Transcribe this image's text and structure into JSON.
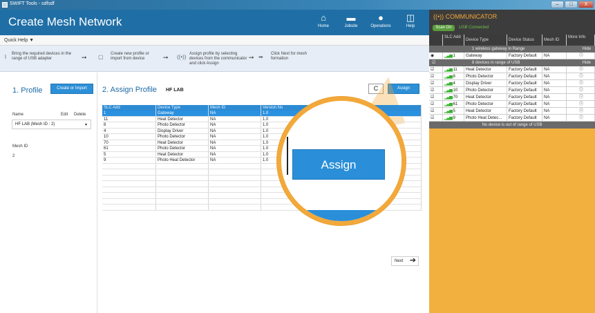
{
  "window": {
    "title": "SWIFT Tools - sdfsdf",
    "controls": [
      "–",
      "□",
      "X"
    ]
  },
  "header": {
    "title": "Create Mesh Network",
    "buttons": [
      {
        "label": "Home",
        "icon": "home-icon",
        "glyph": "⌂"
      },
      {
        "label": "Jobsite",
        "icon": "briefcase-icon",
        "glyph": "▬"
      },
      {
        "label": "Operations",
        "icon": "operations-icon",
        "glyph": "●"
      },
      {
        "label": "Help",
        "icon": "book-icon",
        "glyph": "◫"
      }
    ]
  },
  "quick_help": {
    "label": "Quick Help ▼",
    "steps": [
      "Bring the required devices in the range of USB adapter",
      "Create new profile or import from device",
      "Assign profile by selecting devices from the communicator and click  Assign",
      "Click Next for mesh formation"
    ]
  },
  "profile": {
    "section_title": "1. Profile",
    "create_import_label": "Create or Import",
    "name_label": "Name",
    "edit_label": "Edit",
    "delete_label": "Delete",
    "selected_profile": "HF LAB (Mesh ID : 2)",
    "mesh_id_label": "Mesh ID",
    "mesh_id_value": "2"
  },
  "assign": {
    "section_title": "2. Assign Profile",
    "profile_name": "HF LAB",
    "refresh_glyph": "C",
    "assign_label": "Assign",
    "next_label": "Next",
    "columns": [
      "SLC Add",
      "Device Type",
      "Mesh ID",
      "Version No",
      "",
      ""
    ],
    "rows": [
      {
        "slc": "1",
        "type": "Gateway",
        "mesh": "NA",
        "ver": "1.0"
      },
      {
        "slc": "11",
        "type": "Heat Detector",
        "mesh": "NA",
        "ver": "1.0"
      },
      {
        "slc": "8",
        "type": "Photo Detector",
        "mesh": "NA",
        "ver": "1.0"
      },
      {
        "slc": "4",
        "type": "Display Driver",
        "mesh": "NA",
        "ver": "1.0"
      },
      {
        "slc": "10",
        "type": "Photo Detector",
        "mesh": "NA",
        "ver": "1.0"
      },
      {
        "slc": "70",
        "type": "Heat Detector",
        "mesh": "NA",
        "ver": "1.0"
      },
      {
        "slc": "61",
        "type": "Photo Detector",
        "mesh": "NA",
        "ver": "1.0"
      },
      {
        "slc": "5",
        "type": "Heat Detector",
        "mesh": "NA",
        "ver": "1.0"
      },
      {
        "slc": "9",
        "type": "Photo Heat Detector",
        "mesh": "NA",
        "ver": "1.0"
      }
    ],
    "zoom_assign_label": "Assign",
    "zoom_partial_label": "ign"
  },
  "communicator": {
    "title": "COMMUNICATOR",
    "scan_label": "Scan On",
    "usb_status": "USB Connected",
    "columns": [
      "SLC Add",
      "Device Type",
      "Device Status",
      "Mesh ID",
      "More Info"
    ],
    "gateway_group": {
      "label": "1 wireless gateway in Range",
      "hide": "Hide"
    },
    "gateway_row": {
      "slc": "1",
      "type": "Gateway",
      "status": "Factory Default",
      "mesh": "NA"
    },
    "usb_group": {
      "label": "8 devices in range of USB",
      "hide": "Hide"
    },
    "devices": [
      {
        "slc": "11",
        "type": "Heat Detector",
        "status": "Factory Default",
        "mesh": "NA"
      },
      {
        "slc": "8",
        "type": "Photo Detector",
        "status": "Factory Default",
        "mesh": "NA"
      },
      {
        "slc": "4",
        "type": "Display Driver",
        "status": "Factory Default",
        "mesh": "NA"
      },
      {
        "slc": "10",
        "type": "Photo Detector",
        "status": "Factory Default",
        "mesh": "NA"
      },
      {
        "slc": "70",
        "type": "Heat Detector",
        "status": "Factory Default",
        "mesh": "NA"
      },
      {
        "slc": "61",
        "type": "Photo Detector",
        "status": "Factory Default",
        "mesh": "NA"
      },
      {
        "slc": "5",
        "type": "Heat Detector",
        "status": "Factory Default",
        "mesh": "NA"
      },
      {
        "slc": "9",
        "type": "Photo Heat Detec...",
        "status": "Factory Default",
        "mesh": "NA"
      }
    ],
    "out_of_range": "No device is out of range of USB"
  }
}
